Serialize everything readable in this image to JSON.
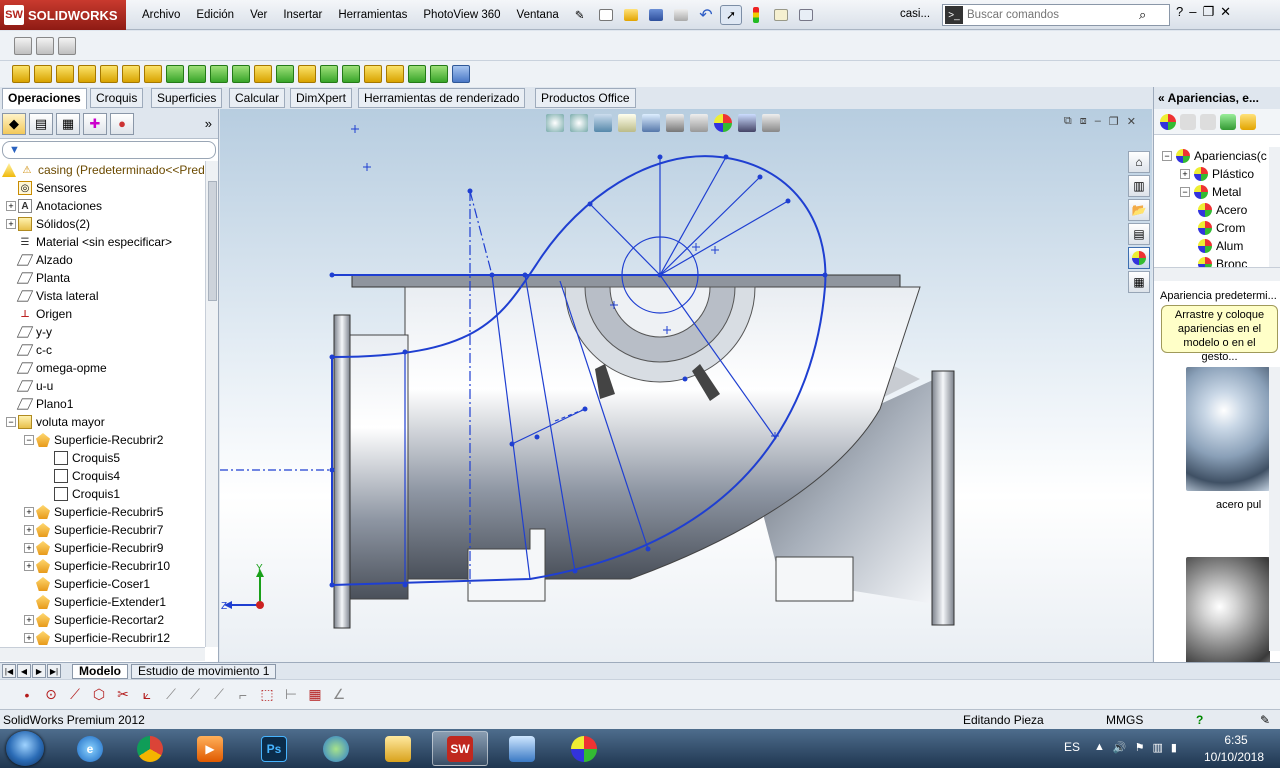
{
  "app": {
    "brand": "SOLIDWORKS",
    "brand_mark": "SW",
    "doc_title": "casi..."
  },
  "menu": [
    "Archivo",
    "Edición",
    "Ver",
    "Insertar",
    "Herramientas",
    "PhotoView 360",
    "Ventana"
  ],
  "search": {
    "placeholder": "Buscar comandos"
  },
  "command_tabs": [
    "Operaciones",
    "Croquis",
    "Superficies",
    "Calcular",
    "DimXpert",
    "Herramientas de renderizado",
    "Productos Office"
  ],
  "feature_tree": {
    "root": "casing  (Predeterminado<<Pred",
    "items": [
      {
        "label": "Sensores",
        "icon": "sensor-icon",
        "indent": 1,
        "expand": ""
      },
      {
        "label": "Anotaciones",
        "icon": "annotation-icon",
        "indent": 1,
        "expand": "+"
      },
      {
        "label": "Sólidos(2)",
        "icon": "solid-bodies-icon",
        "indent": 1,
        "expand": "+"
      },
      {
        "label": "Material <sin especificar>",
        "icon": "material-icon",
        "indent": 1,
        "expand": ""
      },
      {
        "label": "Alzado",
        "icon": "plane-icon",
        "indent": 1,
        "expand": ""
      },
      {
        "label": "Planta",
        "icon": "plane-icon",
        "indent": 1,
        "expand": ""
      },
      {
        "label": "Vista lateral",
        "icon": "plane-icon",
        "indent": 1,
        "expand": ""
      },
      {
        "label": "Origen",
        "icon": "origin-icon",
        "indent": 1,
        "expand": ""
      },
      {
        "label": "y-y",
        "icon": "axis-icon",
        "indent": 1,
        "expand": ""
      },
      {
        "label": "c-c",
        "icon": "axis-icon",
        "indent": 1,
        "expand": ""
      },
      {
        "label": "omega-opme",
        "icon": "plane-icon",
        "indent": 1,
        "expand": ""
      },
      {
        "label": "u-u",
        "icon": "axis-icon",
        "indent": 1,
        "expand": ""
      },
      {
        "label": "Plano1",
        "icon": "plane-icon",
        "indent": 1,
        "expand": ""
      },
      {
        "label": "voluta mayor",
        "icon": "folder-icon",
        "indent": 1,
        "expand": "−"
      },
      {
        "label": "Superficie-Recubrir2",
        "icon": "loft-surface-icon",
        "indent": 2,
        "expand": "−"
      },
      {
        "label": "Croquis5",
        "icon": "sketch-icon",
        "indent": 3,
        "expand": ""
      },
      {
        "label": "Croquis4",
        "icon": "sketch-icon",
        "indent": 3,
        "expand": ""
      },
      {
        "label": "Croquis1",
        "icon": "sketch-icon",
        "indent": 3,
        "expand": ""
      },
      {
        "label": "Superficie-Recubrir5",
        "icon": "loft-surface-icon",
        "indent": 2,
        "expand": "+"
      },
      {
        "label": "Superficie-Recubrir7",
        "icon": "loft-surface-icon",
        "indent": 2,
        "expand": "+"
      },
      {
        "label": "Superficie-Recubrir9",
        "icon": "loft-surface-icon",
        "indent": 2,
        "expand": "+"
      },
      {
        "label": "Superficie-Recubrir10",
        "icon": "loft-surface-icon",
        "indent": 2,
        "expand": "+"
      },
      {
        "label": "Superficie-Coser1",
        "icon": "knit-surface-icon",
        "indent": 2,
        "expand": ""
      },
      {
        "label": "Superficie-Extender1",
        "icon": "extend-surface-icon",
        "indent": 2,
        "expand": ""
      },
      {
        "label": "Superficie-Recortar2",
        "icon": "trim-surface-icon",
        "indent": 2,
        "expand": "+"
      },
      {
        "label": "Superficie-Recubrir12",
        "icon": "loft-surface-icon",
        "indent": 2,
        "expand": "+"
      }
    ]
  },
  "triad": {
    "y": "Y",
    "z": "Z"
  },
  "right_panel": {
    "title": "Apariencias, e...",
    "tree": [
      {
        "label": "Apariencias(c",
        "indent": 0,
        "expand": "−"
      },
      {
        "label": "Plástico",
        "indent": 1,
        "expand": "+"
      },
      {
        "label": "Metal",
        "indent": 1,
        "expand": "−"
      },
      {
        "label": "Acero",
        "indent": 2,
        "expand": ""
      },
      {
        "label": "Crom",
        "indent": 2,
        "expand": ""
      },
      {
        "label": "Alum",
        "indent": 2,
        "expand": ""
      },
      {
        "label": "Bronc",
        "indent": 2,
        "expand": ""
      }
    ],
    "subtitle": "Apariencia predetermi...",
    "tip": "Arrastre y coloque apariencias en el modelo o en el gesto...",
    "swatch1_label": "acero pul"
  },
  "bottom_tabs": [
    "Modelo",
    "Estudio de movimiento 1"
  ],
  "status": {
    "product": "SolidWorks Premium 2012",
    "mode": "Editando Pieza",
    "units": "MMGS",
    "help": "?"
  },
  "taskbar": {
    "lang": "ES",
    "time": "6:35",
    "date": "10/10/2018"
  },
  "colors": {
    "accent": "#1f3fd1",
    "brand": "#b3261e",
    "selection": "#0000e0"
  }
}
